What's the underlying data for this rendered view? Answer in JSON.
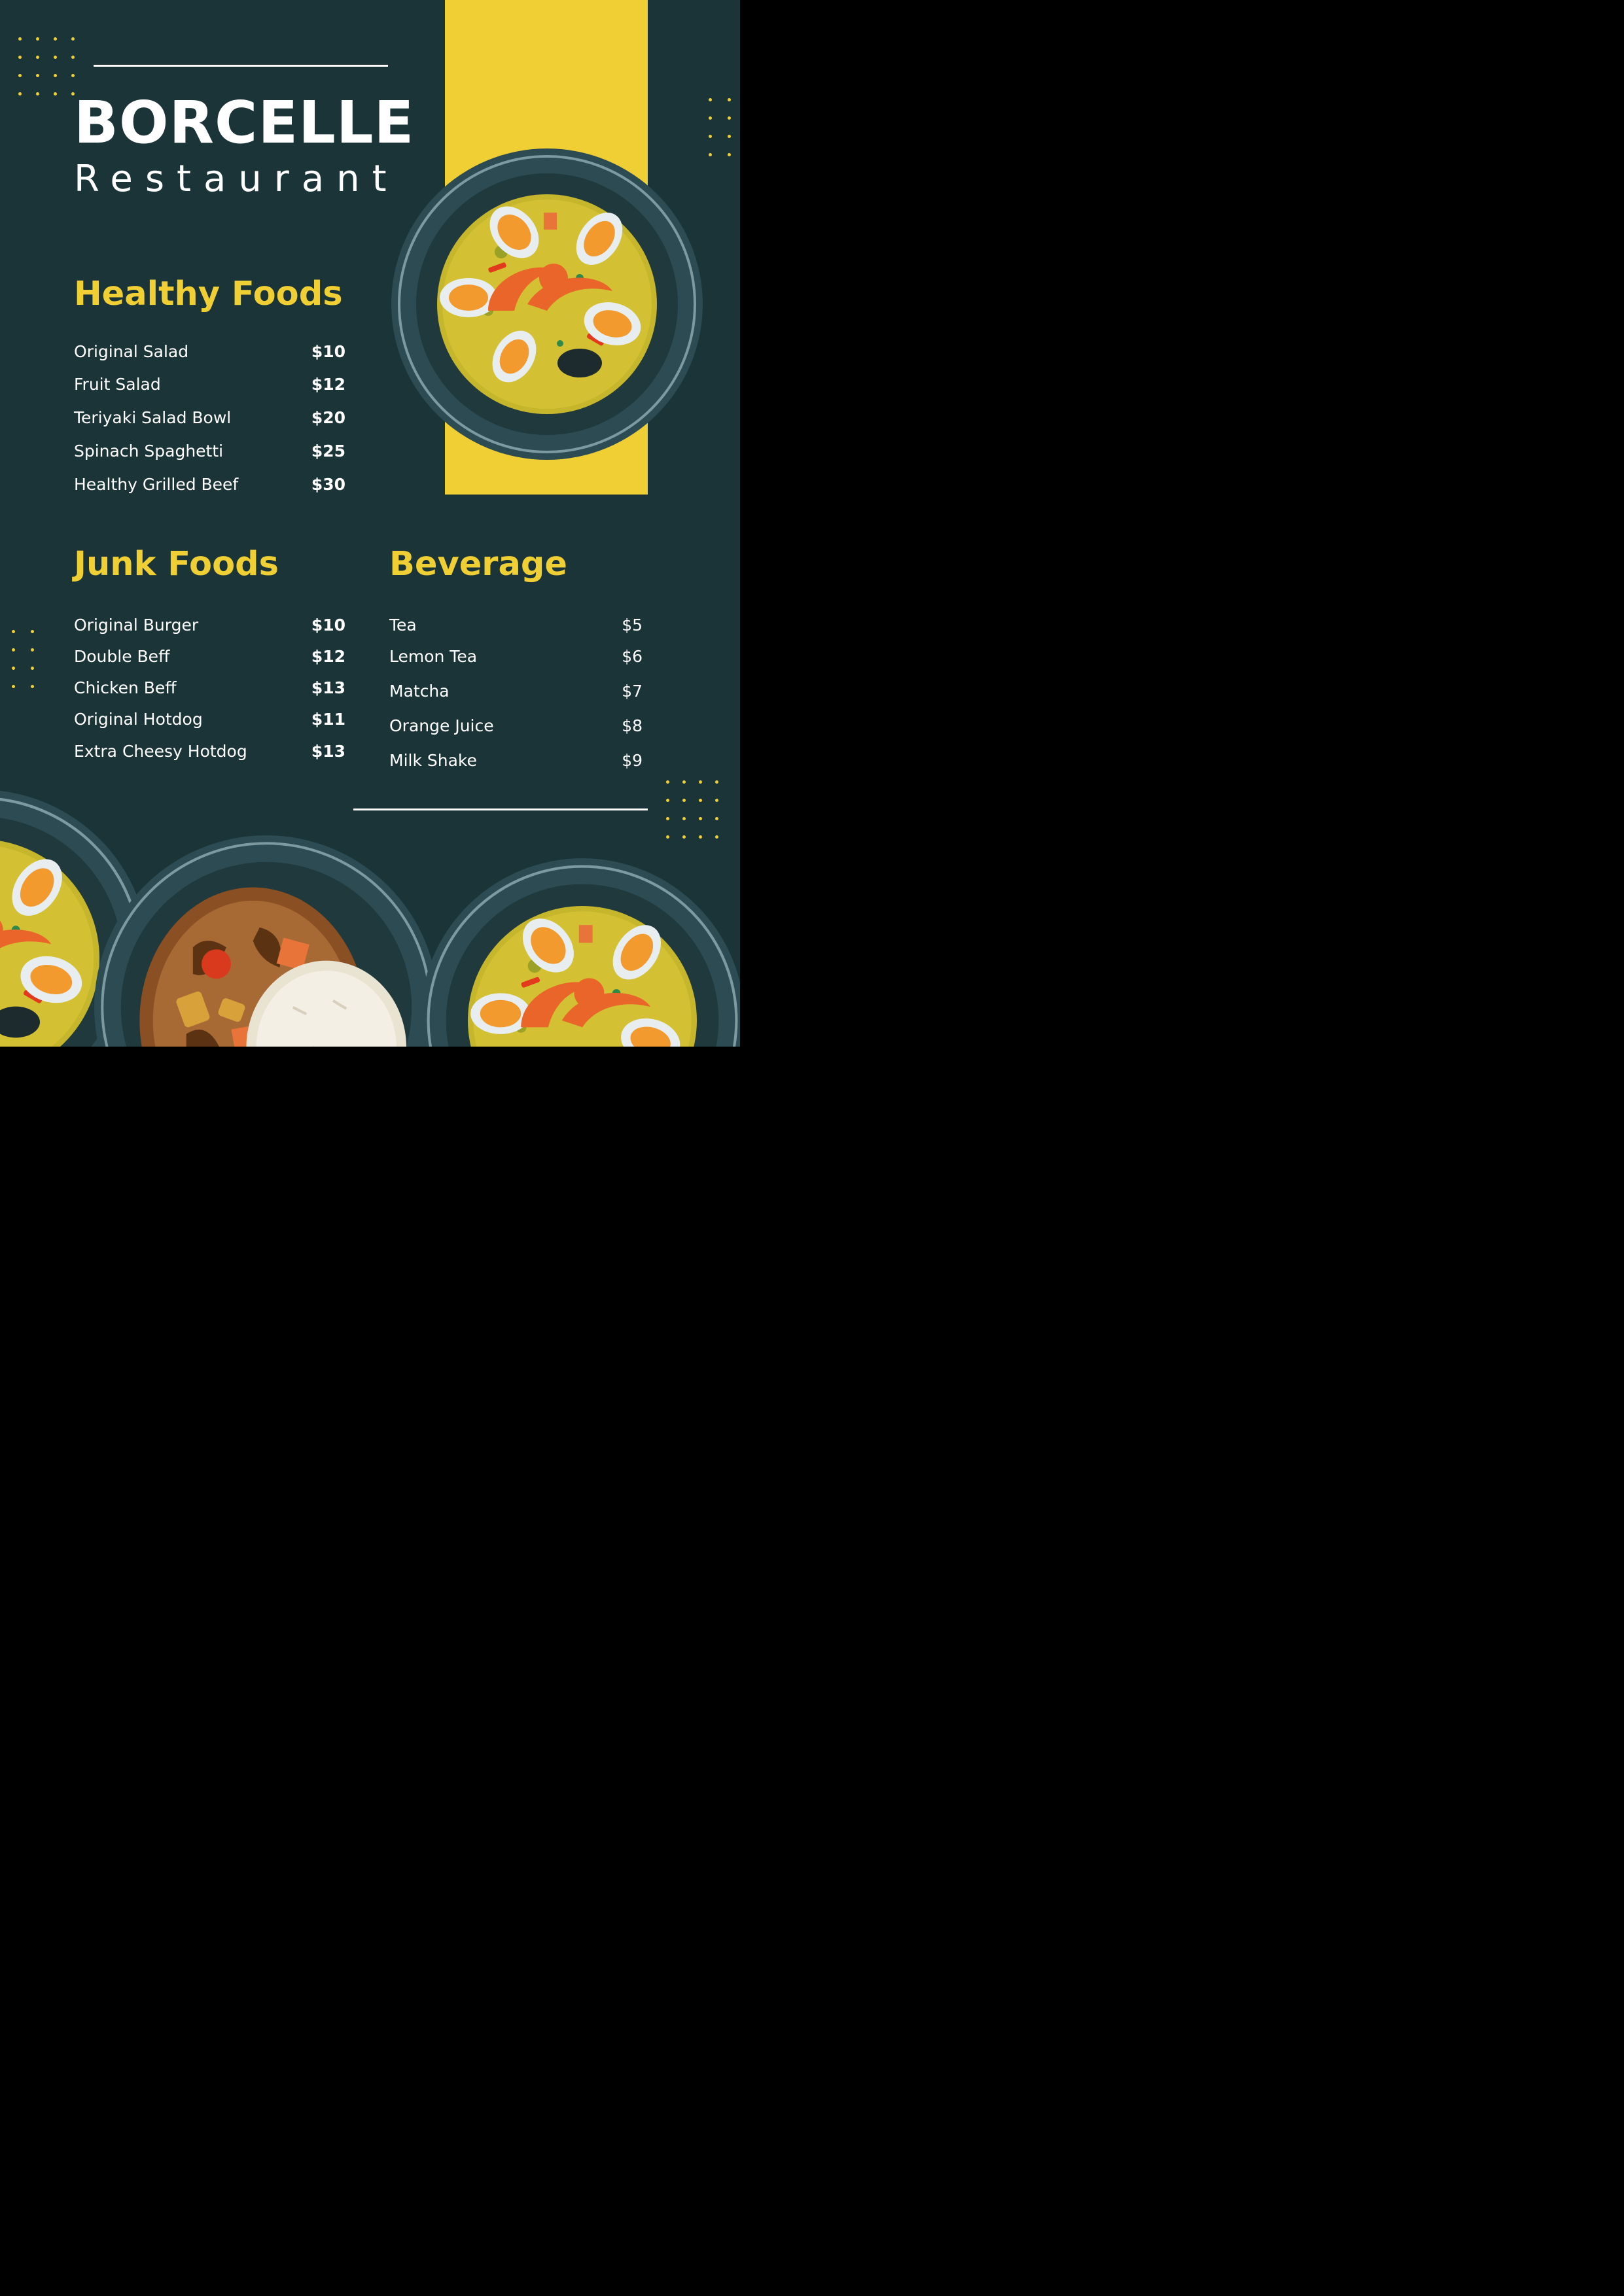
{
  "brand": {
    "name": "BORCELLE",
    "subtitle": "Restaurant"
  },
  "colors": {
    "background": "#1b3437",
    "accent": "#efcf33",
    "text": "#ffffff",
    "plate": "#2c4b53"
  },
  "sections": {
    "healthy": {
      "title": "Healthy Foods",
      "items": [
        {
          "name": "Original Salad",
          "price": "$10"
        },
        {
          "name": "Fruit Salad",
          "price": "$12"
        },
        {
          "name": "Teriyaki Salad Bowl",
          "price": "$20"
        },
        {
          "name": "Spinach Spaghetti",
          "price": "$25"
        },
        {
          "name": "Healthy Grilled Beef",
          "price": "$30"
        }
      ]
    },
    "junk": {
      "title": "Junk Foods",
      "items": [
        {
          "name": "Original Burger",
          "price": "$10"
        },
        {
          "name": "Double Beff",
          "price": "$12"
        },
        {
          "name": "Chicken Beff",
          "price": "$13"
        },
        {
          "name": "Original Hotdog",
          "price": "$11"
        },
        {
          "name": "Extra Cheesy Hotdog",
          "price": "$13"
        }
      ]
    },
    "beverage": {
      "title": "Beverage",
      "items": [
        {
          "name": "Tea",
          "price": "$5"
        },
        {
          "name": "Lemon Tea",
          "price": "$6"
        },
        {
          "name": "Matcha",
          "price": "$7"
        },
        {
          "name": "Orange Juice",
          "price": "$8"
        },
        {
          "name": "Milk Shake",
          "price": "$9"
        }
      ]
    }
  },
  "illustrations": {
    "top": "paella-plate-icon",
    "bottom": [
      "paella-plate-icon",
      "curry-rice-plate-icon",
      "paella-plate-icon"
    ]
  }
}
